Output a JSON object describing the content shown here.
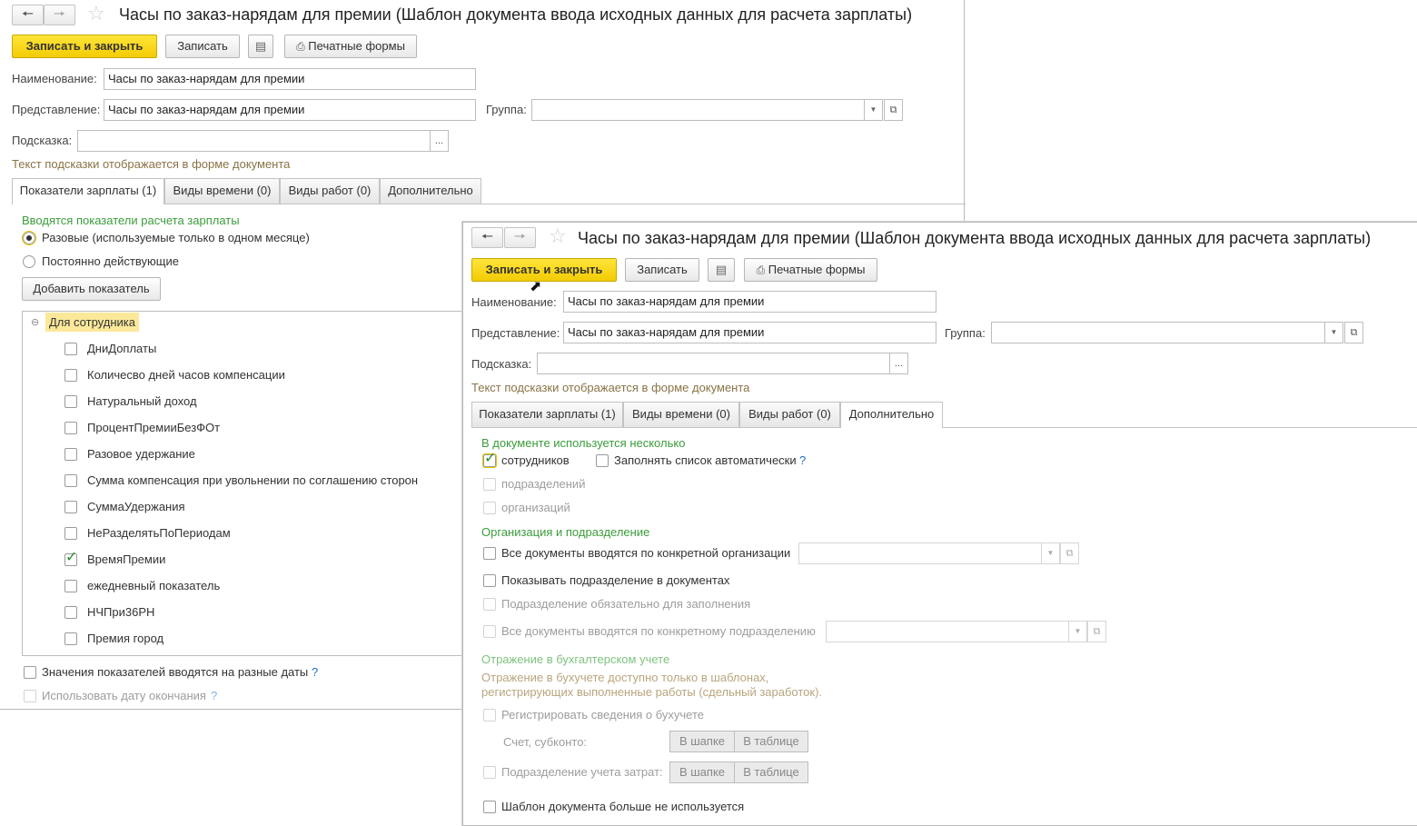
{
  "colors": {
    "accent_yellow": "#f5cf0c",
    "group_green": "#3b9c3b",
    "hint_brown": "#8a7346",
    "help_blue": "#1f6fc5"
  },
  "icons": [
    "back-arrow-icon",
    "forward-arrow-icon",
    "star-icon",
    "document-list-icon",
    "printer-icon",
    "dropdown-icon",
    "open-icon",
    "ellipsis-icon",
    "collapse-icon",
    "checkmark-icon",
    "cursor-icon"
  ],
  "window1": {
    "title": "Часы по заказ-нарядам для премии (Шаблон документа ввода исходных данных для расчета зарплаты)",
    "toolbar": {
      "save_close": "Записать и закрыть",
      "save": "Записать",
      "print": "Печатные формы"
    },
    "fields": {
      "name_label": "Наименование:",
      "name_value": "Часы по заказ-нарядам для премии",
      "repr_label": "Представление:",
      "repr_value": "Часы по заказ-нарядам для премии",
      "group_label": "Группа:",
      "group_value": "",
      "hint_label": "Подсказка:",
      "hint_value": "",
      "ellipsis": "...",
      "hint_note": "Текст подсказки отображается в форме документа"
    },
    "tabs": [
      "Показатели зарплаты (1)",
      "Виды времени (0)",
      "Виды работ (0)",
      "Дополнительно"
    ],
    "indicators": {
      "group_title": "Вводятся показатели расчета зарплаты",
      "radio1": "Разовые (используемые только в одном месяце)",
      "radio2": "Постоянно действующие",
      "add_button": "Добавить показатель",
      "tree_root": "Для сотрудника",
      "items": [
        {
          "label": "ДниДоплаты",
          "checked": false
        },
        {
          "label": "Количесво дней часов компенсации",
          "checked": false
        },
        {
          "label": "Натуральный доход",
          "checked": false
        },
        {
          "label": "ПроцентПремииБезФОт",
          "checked": false
        },
        {
          "label": "Разовое удержание",
          "checked": false
        },
        {
          "label": "Сумма компенсация при увольнении по соглашению сторон",
          "checked": false
        },
        {
          "label": "СуммаУдержания",
          "checked": false
        },
        {
          "label": " НеРазделятьПоПериодам",
          "checked": false
        },
        {
          "label": "ВремяПремии",
          "checked": true
        },
        {
          "label": "ежедневный показатель",
          "checked": false
        },
        {
          "label": "НЧПри36РН",
          "checked": false
        },
        {
          "label": "Премия город",
          "checked": false
        }
      ],
      "different_dates": "Значения показателей вводятся на разные даты",
      "use_end_date": "Использовать дату окончания",
      "help": "?"
    }
  },
  "window2": {
    "title": "Часы по заказ-нарядам для премии (Шаблон документа ввода исходных данных для расчета зарплаты)",
    "toolbar": {
      "save_close": "Записать и закрыть",
      "save": "Записать",
      "print": "Печатные формы"
    },
    "fields": {
      "name_label": "Наименование:",
      "name_value": "Часы по заказ-нарядам для премии",
      "repr_label": "Представление:",
      "repr_value": "Часы по заказ-нарядам для премии",
      "group_label": "Группа:",
      "group_value": "",
      "hint_label": "Подсказка:",
      "hint_value": "",
      "ellipsis": "...",
      "hint_note": "Текст подсказки отображается в форме документа"
    },
    "tabs": [
      "Показатели зарплаты (1)",
      "Виды времени (0)",
      "Виды работ (0)",
      "Дополнительно"
    ],
    "additional": {
      "multi_title": "В документе используется несколько",
      "employees": "сотрудников",
      "autofill": "Заполнять список автоматически",
      "departments": "подразделений",
      "organizations": "организаций",
      "org_title": "Организация и подразделение",
      "all_by_org": "Все документы вводятся по конкретной организации",
      "show_dept": "Показывать подразделение в документах",
      "dept_required": "Подразделение обязательно для заполнения",
      "all_by_dept": "Все документы вводятся по конкретному подразделению",
      "acc_title": "Отражение в бухгалтерском учете",
      "acc_note1": "Отражение в бухучете доступно только в шаблонах,",
      "acc_note2": "регистрирующих выполненные работы (сдельный заработок).",
      "register_acc": "Регистрировать сведения о бухучете",
      "account_label": "Счет, субконто:",
      "cost_dept": "Подразделение учета затрат:",
      "in_header": "В шапке",
      "in_table": "В таблице",
      "not_used": "Шаблон документа больше не используется",
      "help": "?"
    }
  }
}
